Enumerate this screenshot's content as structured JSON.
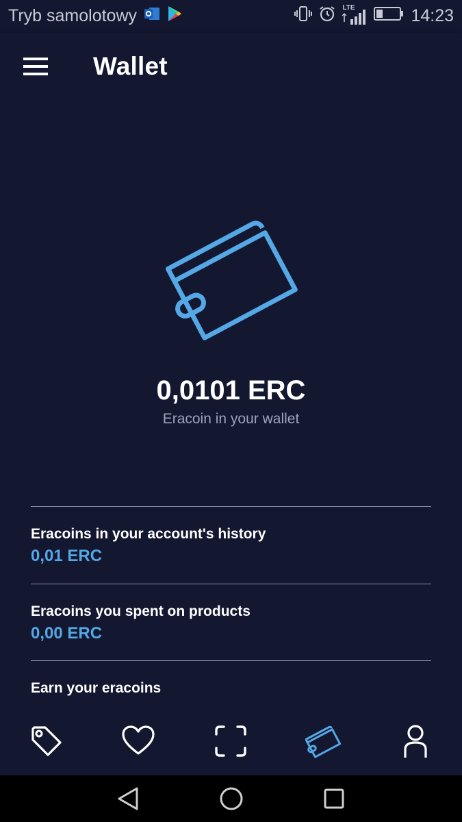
{
  "status_bar": {
    "carrier": "Tryb samolotowy",
    "network": "LTE",
    "time": "14:23",
    "icons": [
      "outlook-icon",
      "play-store-icon",
      "vibrate-icon",
      "alarm-icon",
      "signal-icon",
      "battery-icon"
    ]
  },
  "app_bar": {
    "title": "Wallet"
  },
  "wallet": {
    "balance": "0,0101 ERC",
    "balance_caption": "Eracoin in your wallet"
  },
  "rows": [
    {
      "title": "Eracoins in your account's history",
      "value": "0,01 ERC"
    },
    {
      "title": "Eracoins you spent on products",
      "value": "0,00 ERC"
    },
    {
      "title": "Earn your eracoins"
    }
  ],
  "bottom_nav": {
    "items": [
      "tag-icon",
      "heart-icon",
      "scan-icon",
      "wallet-icon",
      "profile-icon"
    ],
    "active": "wallet-icon"
  },
  "colors": {
    "background": "#131730",
    "accent": "#54a8e6",
    "text_secondary": "#9ea3b8",
    "divider": "#8b90a6"
  }
}
